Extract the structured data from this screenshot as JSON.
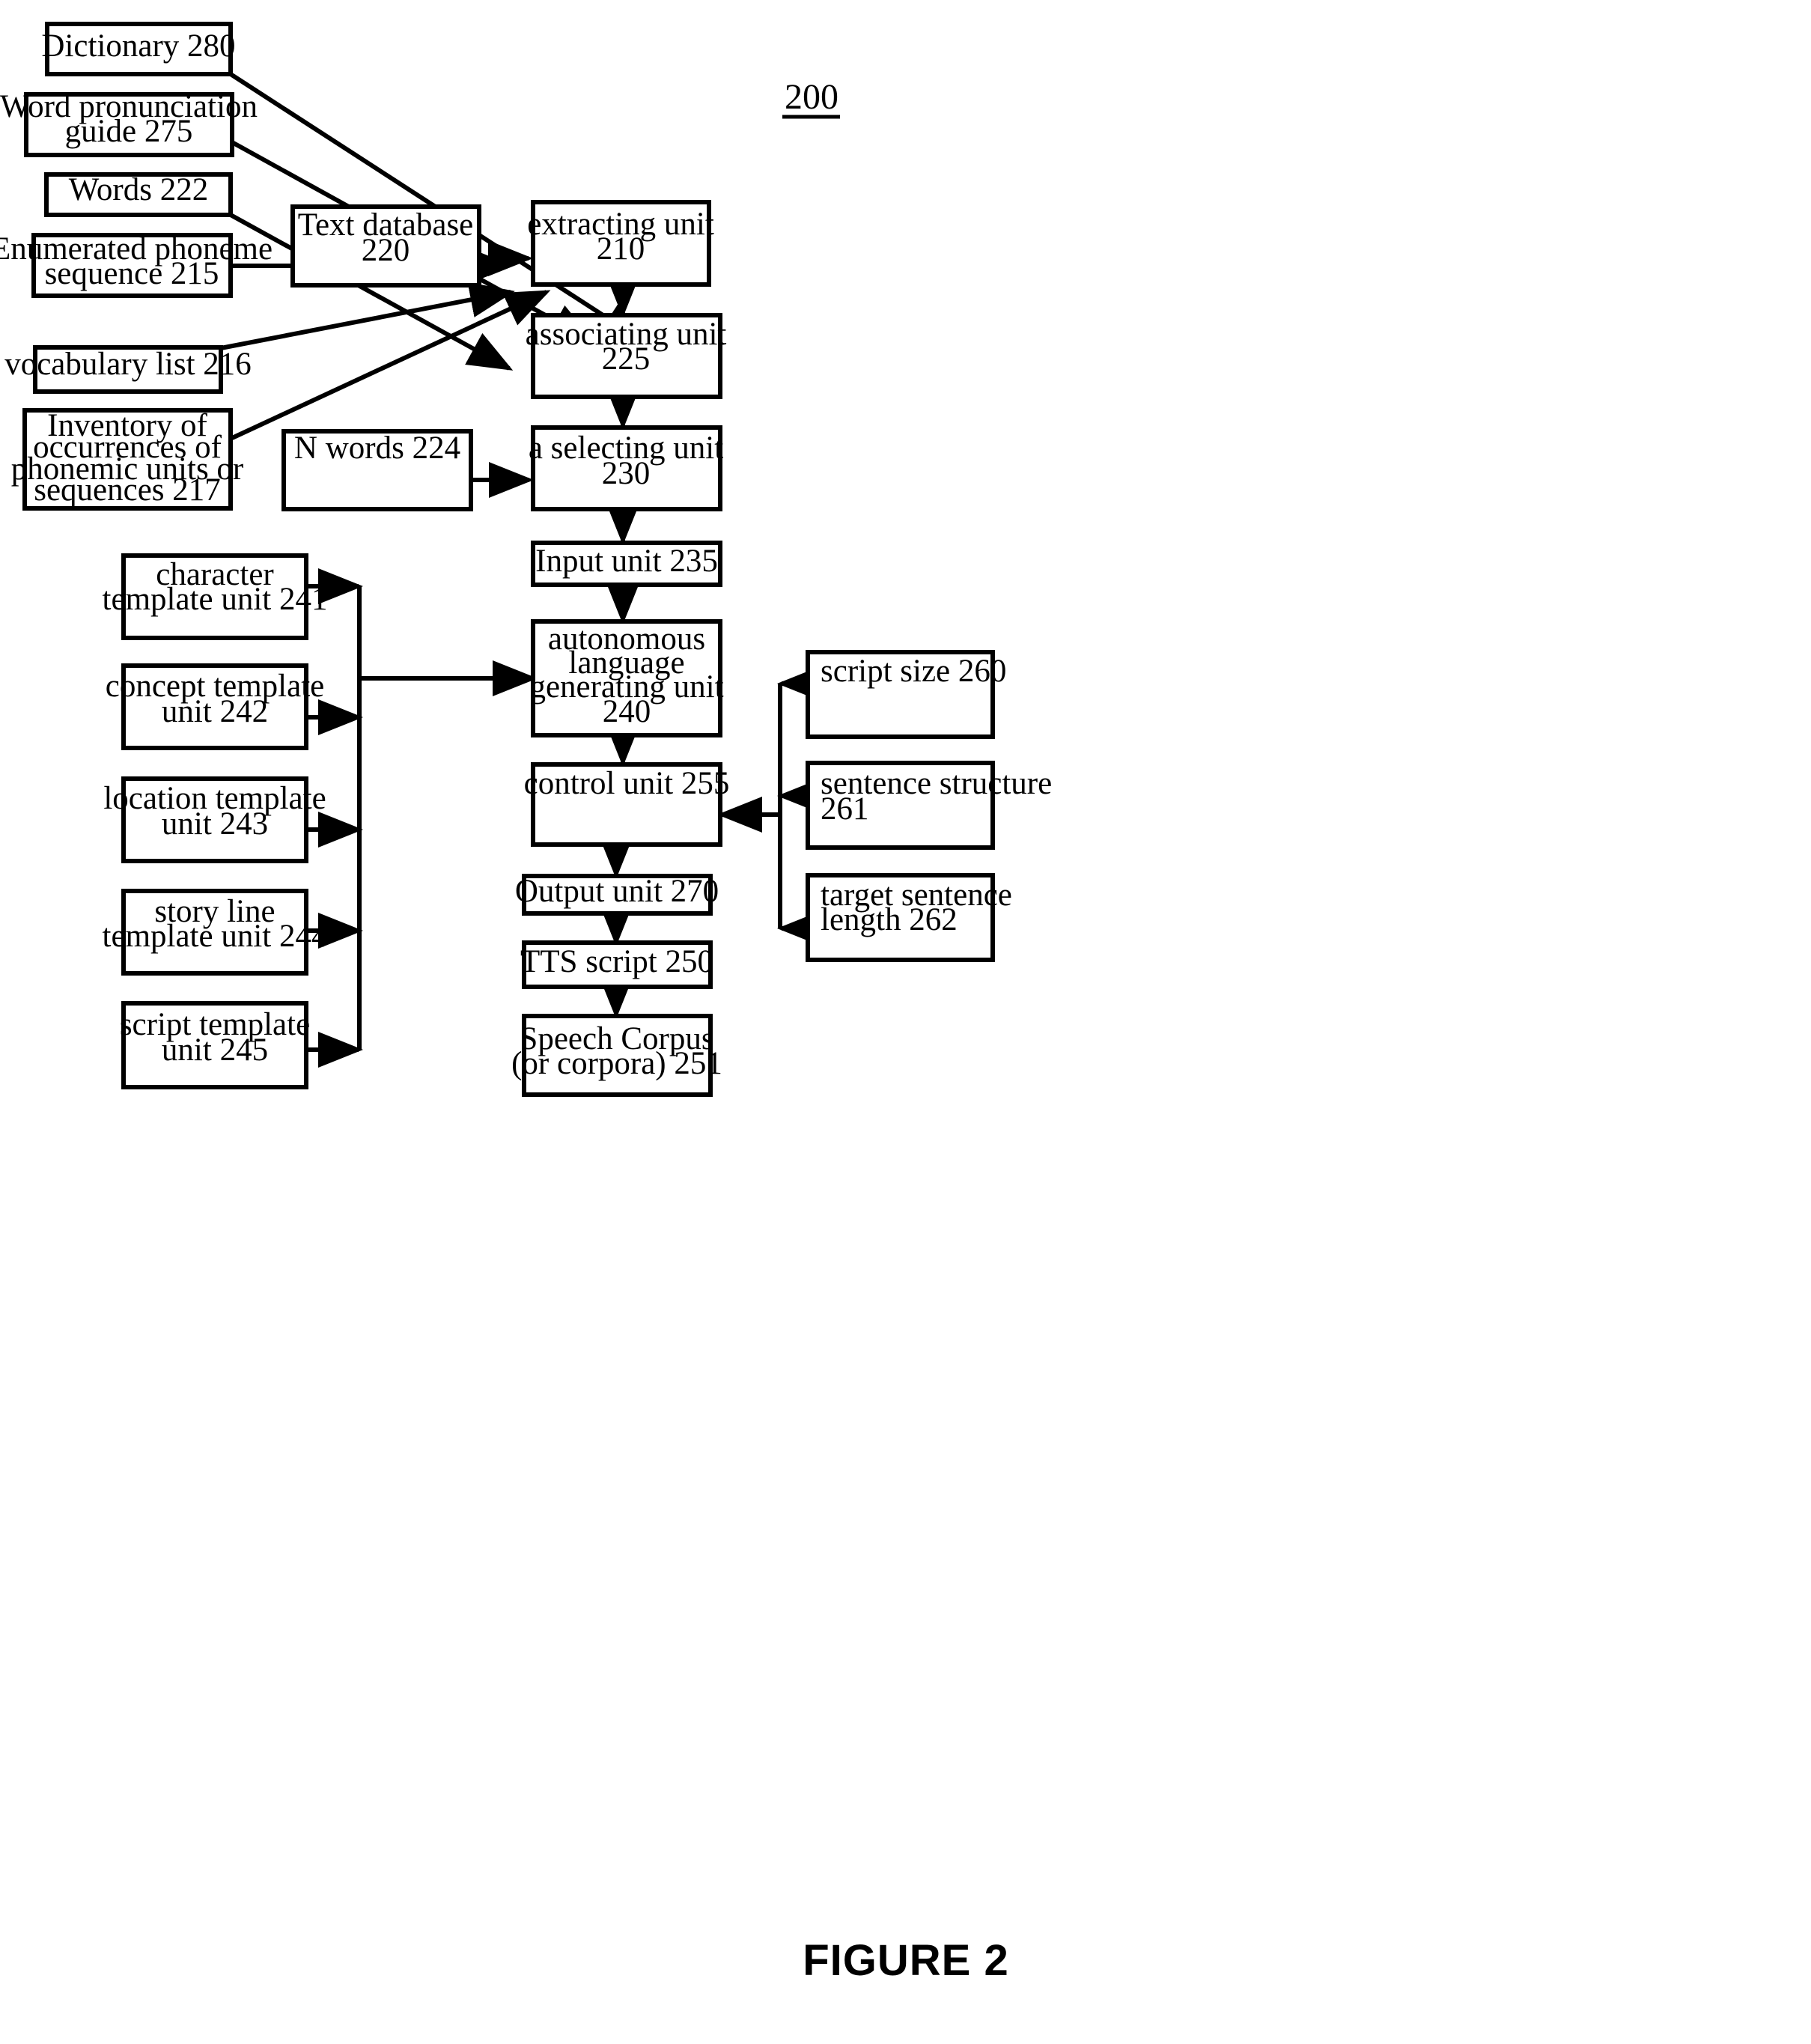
{
  "figure": {
    "caption": "FIGURE 2",
    "system_ref": "200"
  },
  "boxes": {
    "dictionary_280": "Dictionary 280",
    "word_pronunciation_guide_275_l1": "Word pronunciation",
    "word_pronunciation_guide_275_l2": "guide 275",
    "words_222": "Words 222",
    "enumerated_phoneme_215_l1": "Enumerated phoneme",
    "enumerated_phoneme_215_l2": "sequence 215",
    "vocabulary_list_216": "vocabulary list 216",
    "inventory_217_l1": "Inventory of",
    "inventory_217_l2": "occurrences of",
    "inventory_217_l3": "phonemic units or",
    "inventory_217_l4": "sequences 217",
    "text_database_220_l1": "Text database",
    "text_database_220_l2": "220",
    "extracting_unit_210_l1": "extracting unit",
    "extracting_unit_210_l2": "210",
    "associating_unit_225_l1": "associating unit",
    "associating_unit_225_l2": "225",
    "n_words_224": "N words 224",
    "selecting_unit_230_l1": "a selecting unit",
    "selecting_unit_230_l2": "230",
    "input_unit_235": "Input unit 235",
    "character_template_241_l1": "character",
    "character_template_241_l2": "template unit 241",
    "concept_template_242_l1": "concept template",
    "concept_template_242_l2": "unit 242",
    "location_template_243_l1": "location template",
    "location_template_243_l2": "unit 243",
    "story_line_template_244_l1": "story line",
    "story_line_template_244_l2": "template unit 244",
    "script_template_245_l1": "script template",
    "script_template_245_l2": "unit 245",
    "autonomous_lang_240_l1": "autonomous",
    "autonomous_lang_240_l2": "language",
    "autonomous_lang_240_l3": "generating unit",
    "autonomous_lang_240_l4": "240",
    "control_unit_255": "control unit 255",
    "output_unit_270": "Output unit 270",
    "tts_script_250": "TTS script 250",
    "speech_corpus_251_l1": "Speech Corpus",
    "speech_corpus_251_l2": "(or corpora) 251",
    "script_size_260": "script size 260",
    "sentence_structure_261_l1": "sentence structure",
    "sentence_structure_261_l2": "261",
    "target_sentence_length_262_l1": "target sentence",
    "target_sentence_length_262_l2": "length 262"
  },
  "colors": {
    "stroke": "#000000",
    "fill": "#ffffff"
  }
}
